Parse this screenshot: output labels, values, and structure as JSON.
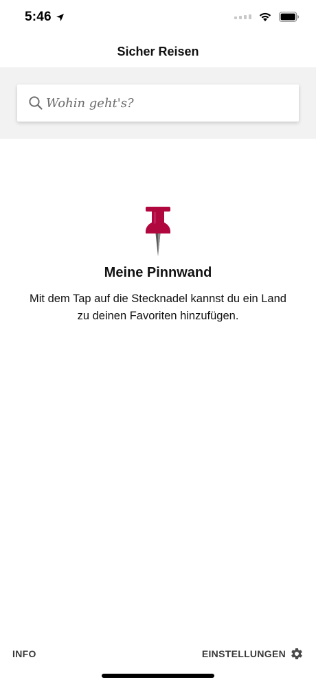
{
  "status_bar": {
    "time": "5:46",
    "icons": [
      "location-arrow-icon",
      "cellular-signal-icon",
      "wifi-icon",
      "battery-icon"
    ]
  },
  "header": {
    "title": "Sicher Reisen"
  },
  "search": {
    "placeholder": "Wohin geht's?",
    "icon": "search-icon"
  },
  "empty_state": {
    "icon": "pushpin-icon",
    "title": "Meine Pinnwand",
    "text": "Mit dem Tap auf die Stecknadel kannst du ein Land zu deinen Favoriten hinzufügen."
  },
  "bottom_bar": {
    "info_label": "INFO",
    "settings_label": "EINSTELLUNGEN",
    "settings_icon": "gear-icon"
  },
  "colors": {
    "pin": "#b0073f",
    "search_background": "#f2f2f2",
    "label_gray": "#3a3a3a"
  }
}
